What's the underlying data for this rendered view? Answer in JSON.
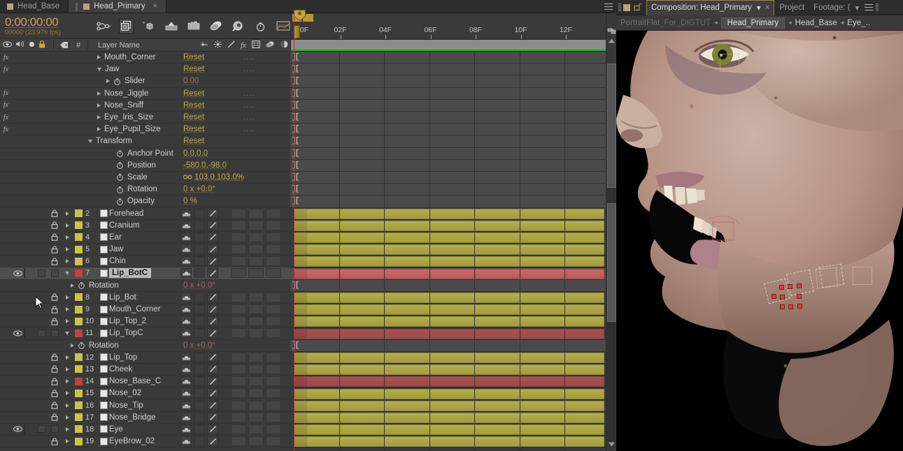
{
  "timeline_panel": {
    "tabs": [
      {
        "label": "Head_Base",
        "active": false,
        "closable": false
      },
      {
        "label": "Head_Primary",
        "active": true,
        "closable": true
      }
    ],
    "close_glyph": "×",
    "panel_menu_icon": "hamburger-menu-icon",
    "timecode": {
      "current": "0:00:00:00",
      "frames_and_rate": "00000 (23.976 fps)"
    },
    "toolbar_icons": [
      "search-filter-icon",
      "composition-mini-flowchart-icon",
      "draft-3d-icon",
      "hide-shy-layers-icon",
      "frame-blending-icon",
      "motion-blur-icon",
      "brainstorm-icon",
      "auto-keyframe-icon",
      "graph-editor-icon"
    ],
    "columns": {
      "eye_icon": "visibility-eye-icon",
      "audio_icon": "audio-speaker-icon",
      "solo_icon": "solo-circle-icon",
      "lock_icon": "lock-icon",
      "label_icon": "label-tag-icon",
      "number_header": "#",
      "name_header": "Layer Name",
      "switch_icons": [
        "shy-icon",
        "collapse-transformations-icon",
        "quality-icon",
        "effects-fx-icon",
        "frame-blend-icon",
        "motion-blur-icon",
        "adjustment-layer-icon",
        "three-d-layer-icon"
      ]
    },
    "ruler": {
      "labels": [
        "00F",
        "02F",
        "04F",
        "06F",
        "08F",
        "10F",
        "12F"
      ],
      "work_area_color": "#b9972f",
      "playhead_color": "#c02a2a"
    },
    "scrollbar": {
      "visible": true,
      "orientation": "vertical"
    },
    "properties": [
      {
        "fx": true,
        "indent": 3,
        "twirl": "right",
        "name": "Mouth_Corner",
        "value": "Reset",
        "value_style": "reset",
        "dots": "....",
        "expr": "]["
      },
      {
        "fx": true,
        "indent": 3,
        "twirl": "down",
        "name": "Jaw",
        "value": "Reset",
        "value_style": "reset",
        "dots": "....",
        "expr": "]["
      },
      {
        "fx": false,
        "indent": 4,
        "twirl": "right",
        "stopwatch": true,
        "name": "Slider",
        "value": "0.00",
        "value_style": "dim",
        "dots": "",
        "expr": "]["
      },
      {
        "fx": true,
        "indent": 3,
        "twirl": "right",
        "name": "Nose_Jiggle",
        "value": "Reset",
        "value_style": "reset",
        "dots": "....",
        "expr": "]["
      },
      {
        "fx": true,
        "indent": 3,
        "twirl": "right",
        "name": "Nose_Sniff",
        "value": "Reset",
        "value_style": "reset",
        "dots": "....",
        "expr": "]["
      },
      {
        "fx": true,
        "indent": 3,
        "twirl": "right",
        "name": "Eye_Iris_Size",
        "value": "Reset",
        "value_style": "reset",
        "dots": "....",
        "expr": "]["
      },
      {
        "fx": true,
        "indent": 3,
        "twirl": "right",
        "name": "Eye_Pupil_Size",
        "value": "Reset",
        "value_style": "reset",
        "dots": "....",
        "expr": "]["
      },
      {
        "fx": false,
        "indent": 2,
        "twirl": "down",
        "name": "Transform",
        "value": "Reset",
        "value_style": "reset",
        "dots": "",
        "expr": "]["
      },
      {
        "fx": false,
        "indent": 4,
        "twirl": "none",
        "stopwatch": true,
        "name": "Anchor Point",
        "value": "0.0,0.0",
        "value_style": "num",
        "dots": "",
        "expr": "]["
      },
      {
        "fx": false,
        "indent": 4,
        "twirl": "none",
        "stopwatch": true,
        "name": "Position",
        "value": "-580.0,-98.0",
        "value_style": "num",
        "dots": "",
        "expr": "]["
      },
      {
        "fx": false,
        "indent": 4,
        "twirl": "none",
        "stopwatch": true,
        "name": "Scale",
        "value": "103.0,103.0%",
        "value_style": "num",
        "link_icon": "scale-link-icon",
        "dots": "",
        "expr": "]["
      },
      {
        "fx": false,
        "indent": 4,
        "twirl": "none",
        "stopwatch": true,
        "name": "Rotation",
        "value": "0 x +0.0°",
        "value_style": "num",
        "dots": "",
        "expr": "]["
      },
      {
        "fx": false,
        "indent": 4,
        "twirl": "none",
        "stopwatch": true,
        "name": "Opacity",
        "value": "0 %",
        "value_style": "num",
        "dots": "",
        "expr": "]["
      }
    ],
    "layers": [
      {
        "num": "2",
        "name": "Forehead",
        "color": "#cbc14b",
        "locked": true,
        "visible": false,
        "selected": false,
        "twirl": "right",
        "bar": "olive"
      },
      {
        "num": "3",
        "name": "Cranium",
        "color": "#cbc14b",
        "locked": true,
        "visible": false,
        "selected": false,
        "twirl": "right",
        "bar": "olive"
      },
      {
        "num": "4",
        "name": "Ear",
        "color": "#cbc14b",
        "locked": true,
        "visible": false,
        "selected": false,
        "twirl": "right",
        "bar": "olive"
      },
      {
        "num": "5",
        "name": "Jaw",
        "color": "#cbc14b",
        "locked": true,
        "visible": false,
        "selected": false,
        "twirl": "right",
        "bar": "olive"
      },
      {
        "num": "6",
        "name": "Chin",
        "color": "#cbc14b",
        "locked": true,
        "visible": false,
        "selected": false,
        "twirl": "right",
        "bar": "olive"
      },
      {
        "num": "7",
        "name": "Lip_BotC",
        "color": "#c5413c",
        "locked": false,
        "visible": true,
        "selected": true,
        "twirl": "down",
        "bar": "red"
      },
      {
        "num": "8",
        "name": "Lip_Bot",
        "color": "#cbc14b",
        "locked": true,
        "visible": false,
        "selected": false,
        "twirl": "right",
        "bar": "olive",
        "cursor": true
      },
      {
        "num": "9",
        "name": "Mouth_Corner",
        "color": "#cbc14b",
        "locked": true,
        "visible": false,
        "selected": false,
        "twirl": "right",
        "bar": "olive"
      },
      {
        "num": "10",
        "name": "Lip_Top_2",
        "color": "#cbc14b",
        "locked": true,
        "visible": false,
        "selected": false,
        "twirl": "right",
        "bar": "olive"
      },
      {
        "num": "11",
        "name": "Lip_TopC",
        "color": "#c5413c",
        "locked": false,
        "visible": true,
        "selected": false,
        "twirl": "down",
        "bar": "darkred"
      },
      {
        "num": "12",
        "name": "Lip_Top",
        "color": "#cbc14b",
        "locked": true,
        "visible": false,
        "selected": false,
        "twirl": "right",
        "bar": "olive"
      },
      {
        "num": "13",
        "name": "Cheek",
        "color": "#cbc14b",
        "locked": true,
        "visible": false,
        "selected": false,
        "twirl": "right",
        "bar": "olive"
      },
      {
        "num": "14",
        "name": "Nose_Base_C",
        "color": "#c5413c",
        "locked": true,
        "visible": false,
        "selected": false,
        "twirl": "right",
        "bar": "darkred"
      },
      {
        "num": "15",
        "name": "Nose_02",
        "color": "#cbc14b",
        "locked": true,
        "visible": false,
        "selected": false,
        "twirl": "right",
        "bar": "olive"
      },
      {
        "num": "16",
        "name": "Nose_Tip",
        "color": "#cbc14b",
        "locked": true,
        "visible": false,
        "selected": false,
        "twirl": "right",
        "bar": "olive"
      },
      {
        "num": "17",
        "name": "Nose_Bridge",
        "color": "#cbc14b",
        "locked": true,
        "visible": false,
        "selected": false,
        "twirl": "right",
        "bar": "olive"
      },
      {
        "num": "18",
        "name": "Eye",
        "color": "#cbc14b",
        "locked": false,
        "visible": true,
        "selected": false,
        "twirl": "right",
        "bar": "olive"
      },
      {
        "num": "19",
        "name": "EyeBrow_02",
        "color": "#cbc14b",
        "locked": true,
        "visible": false,
        "selected": false,
        "twirl": "right",
        "bar": "olive"
      }
    ],
    "layer_sub_rows": [
      {
        "after_layer": "7",
        "name": "Rotation",
        "value": "0 x +0.0°",
        "expr": "]["
      },
      {
        "after_layer": "11",
        "name": "Rotation",
        "value": "0 x +0.0°",
        "expr": "]["
      }
    ]
  },
  "viewer_panel": {
    "tabs": [
      {
        "label": "Composition: Head_Primary",
        "active": true,
        "has_caret": true,
        "closable": true
      },
      {
        "label": "Project",
        "active": false,
        "has_caret": false,
        "closable": false
      },
      {
        "label": "Footage: (",
        "active": false,
        "has_caret": true,
        "closable": false
      }
    ],
    "close_glyph": "×",
    "caret_glyph": "▾",
    "lock_icon": "composition-lock-icon",
    "panel_menu_icon": "panel-menu-icon",
    "breadcrumb": {
      "root": "PortraitFlat_For_DIGTUT",
      "arrow_glyph": "◂",
      "items": [
        "Head_Primary",
        "Head_Base",
        "Eye_.."
      ],
      "current_index": 0
    },
    "canvas": {
      "background": "#000000",
      "selection_boxes_count": 5,
      "eye_selection_box": "eye-layer-selection-box",
      "puppet_pins_count": 9,
      "pin_color": "#e03c3c",
      "selection_stroke_color": "#d8cfb4"
    }
  }
}
